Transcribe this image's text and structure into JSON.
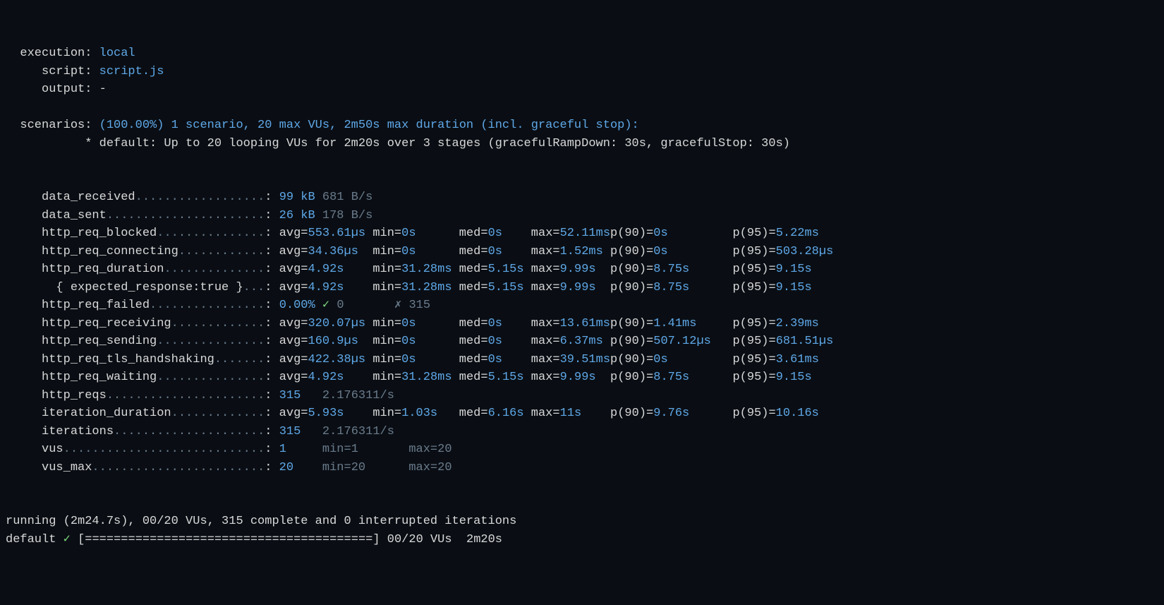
{
  "header": {
    "execution_label": "  execution:",
    "execution_value": "local",
    "script_label": "     script:",
    "script_value": "script.js",
    "output_label": "     output:",
    "output_value": "-",
    "scenarios_label": "  scenarios:",
    "scenarios_value": "(100.00%) 1 scenario, 20 max VUs, 2m50s max duration (incl. graceful stop):",
    "scenarios_detail": "           * default: Up to 20 looping VUs for 2m20s over 3 stages (gracefulRampDown: 30s, gracefulStop: 30s)"
  },
  "metrics": {
    "data_received": {
      "name": "     data_received",
      "dots": "..................",
      "value": "99 kB",
      "rate": "681 B/s"
    },
    "data_sent": {
      "name": "     data_sent",
      "dots": "......................",
      "value": "26 kB",
      "rate": "178 B/s"
    },
    "http_req_blocked": {
      "name": "     http_req_blocked",
      "dots": "...............",
      "avg": "553.61µs",
      "min": "0s",
      "med": "0s",
      "max": "52.11ms",
      "p90": "0s",
      "p95": "5.22ms"
    },
    "http_req_connecting": {
      "name": "     http_req_connecting",
      "dots": "............",
      "avg": "34.36µs",
      "min": "0s",
      "med": "0s",
      "max": "1.52ms",
      "p90": "0s",
      "p95": "503.28µs"
    },
    "http_req_duration": {
      "name": "     http_req_duration",
      "dots": "..............",
      "avg": "4.92s",
      "min": "31.28ms",
      "med": "5.15s",
      "max": "9.99s",
      "p90": "8.75s",
      "p95": "9.15s"
    },
    "http_req_expected": {
      "name": "       { expected_response:true }",
      "dots": "...",
      "avg": "4.92s",
      "min": "31.28ms",
      "med": "5.15s",
      "max": "9.99s",
      "p90": "8.75s",
      "p95": "9.15s"
    },
    "http_req_failed": {
      "name": "     http_req_failed",
      "dots": "................",
      "value": "0.00%",
      "check": "✓",
      "pass": "0",
      "fail_mark": "✗",
      "fail": "315"
    },
    "http_req_receiving": {
      "name": "     http_req_receiving",
      "dots": ".............",
      "avg": "320.07µs",
      "min": "0s",
      "med": "0s",
      "max": "13.61ms",
      "p90": "1.41ms",
      "p95": "2.39ms"
    },
    "http_req_sending": {
      "name": "     http_req_sending",
      "dots": "...............",
      "avg": "160.9µs",
      "min": "0s",
      "med": "0s",
      "max": "6.37ms",
      "p90": "507.12µs",
      "p95": "681.51µs"
    },
    "http_req_tls": {
      "name": "     http_req_tls_handshaking",
      "dots": ".......",
      "avg": "422.38µs",
      "min": "0s",
      "med": "0s",
      "max": "39.51ms",
      "p90": "0s",
      "p95": "3.61ms"
    },
    "http_req_waiting": {
      "name": "     http_req_waiting",
      "dots": "...............",
      "avg": "4.92s",
      "min": "31.28ms",
      "med": "5.15s",
      "max": "9.99s",
      "p90": "8.75s",
      "p95": "9.15s"
    },
    "http_reqs": {
      "name": "     http_reqs",
      "dots": "......................",
      "value": "315",
      "rate": "2.176311/s"
    },
    "iteration_duration": {
      "name": "     iteration_duration",
      "dots": ".............",
      "avg": "5.93s",
      "min": "1.03s",
      "med": "6.16s",
      "max": "11s",
      "p90": "9.76s",
      "p95": "10.16s"
    },
    "iterations": {
      "name": "     iterations",
      "dots": ".....................",
      "value": "315",
      "rate": "2.176311/s"
    },
    "vus": {
      "name": "     vus",
      "dots": "............................",
      "value": "1",
      "min": "min=1",
      "max": "max=20"
    },
    "vus_max": {
      "name": "     vus_max",
      "dots": "........................",
      "value": "20",
      "min": "min=20",
      "max": "max=20"
    }
  },
  "footer": {
    "running_line": "running (2m24.7s), 00/20 VUs, 315 complete and 0 interrupted iterations",
    "progress_label": "default",
    "progress_check": "✓",
    "progress_bar": "[========================================]",
    "progress_vus": "00/20 VUs",
    "progress_time": "2m20s"
  },
  "cols": {
    "avg": 13,
    "min": 12,
    "med": 10,
    "max": 11,
    "p90": 17,
    "p95": 0
  }
}
